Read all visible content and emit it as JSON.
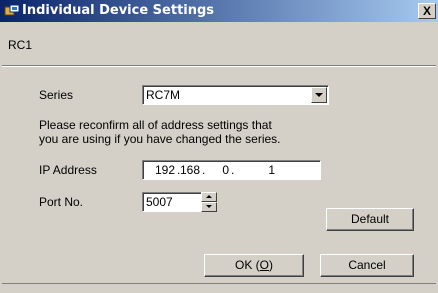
{
  "window": {
    "title": "Individual Device Settings",
    "close_glyph": "X"
  },
  "device_name": "RC1",
  "series": {
    "label": "Series",
    "value": "RC7M"
  },
  "notice": {
    "line1": "Please reconfirm all of address settings that",
    "line2": "you are using if you have changed the series."
  },
  "ip": {
    "label": "IP Address",
    "oct1": "192",
    "oct2": "168",
    "oct3": "0",
    "oct4": "1"
  },
  "port": {
    "label": "Port No.",
    "value": "5007"
  },
  "buttons": {
    "default": "Default",
    "ok_prefix": "OK (",
    "ok_key": "O",
    "ok_suffix": ")",
    "cancel": "Cancel"
  }
}
